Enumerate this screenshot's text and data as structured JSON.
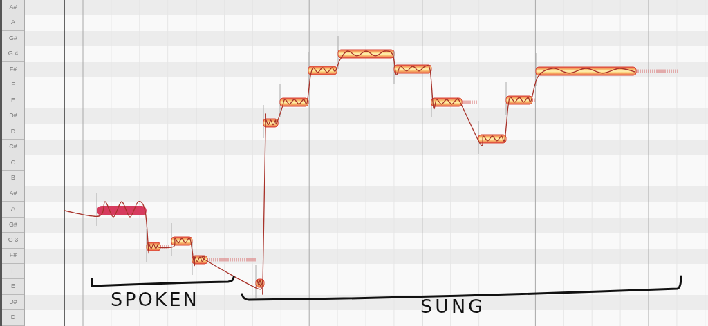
{
  "keyboard": [
    {
      "label": "A#",
      "kind": "sharp"
    },
    {
      "label": "A",
      "kind": "natural"
    },
    {
      "label": "G#",
      "kind": "sharp"
    },
    {
      "label": "G 4",
      "kind": "natural"
    },
    {
      "label": "F#",
      "kind": "sharp"
    },
    {
      "label": "F",
      "kind": "natural"
    },
    {
      "label": "E",
      "kind": "natural"
    },
    {
      "label": "D#",
      "kind": "sharp"
    },
    {
      "label": "D",
      "kind": "natural"
    },
    {
      "label": "C#",
      "kind": "sharp"
    },
    {
      "label": "C",
      "kind": "natural"
    },
    {
      "label": "B",
      "kind": "natural"
    },
    {
      "label": "A#",
      "kind": "sharp"
    },
    {
      "label": "A",
      "kind": "natural"
    },
    {
      "label": "G#",
      "kind": "sharp"
    },
    {
      "label": "G 3",
      "kind": "natural"
    },
    {
      "label": "F#",
      "kind": "sharp"
    },
    {
      "label": "F",
      "kind": "natural"
    },
    {
      "label": "E",
      "kind": "natural"
    },
    {
      "label": "D#",
      "kind": "sharp"
    },
    {
      "label": "D",
      "kind": "natural"
    }
  ],
  "notes": [
    {
      "selected": true
    },
    {
      "selected": false
    },
    {
      "selected": false
    },
    {
      "selected": false
    },
    {
      "selected": false
    },
    {
      "selected": false
    },
    {
      "selected": false
    },
    {
      "selected": false
    },
    {
      "selected": false
    },
    {
      "selected": false
    },
    {
      "selected": false
    },
    {
      "selected": false
    },
    {
      "selected": false
    },
    {
      "selected": false
    }
  ],
  "annotations": [
    {
      "text": "SPOKEN"
    },
    {
      "text": "SUNG"
    }
  ]
}
